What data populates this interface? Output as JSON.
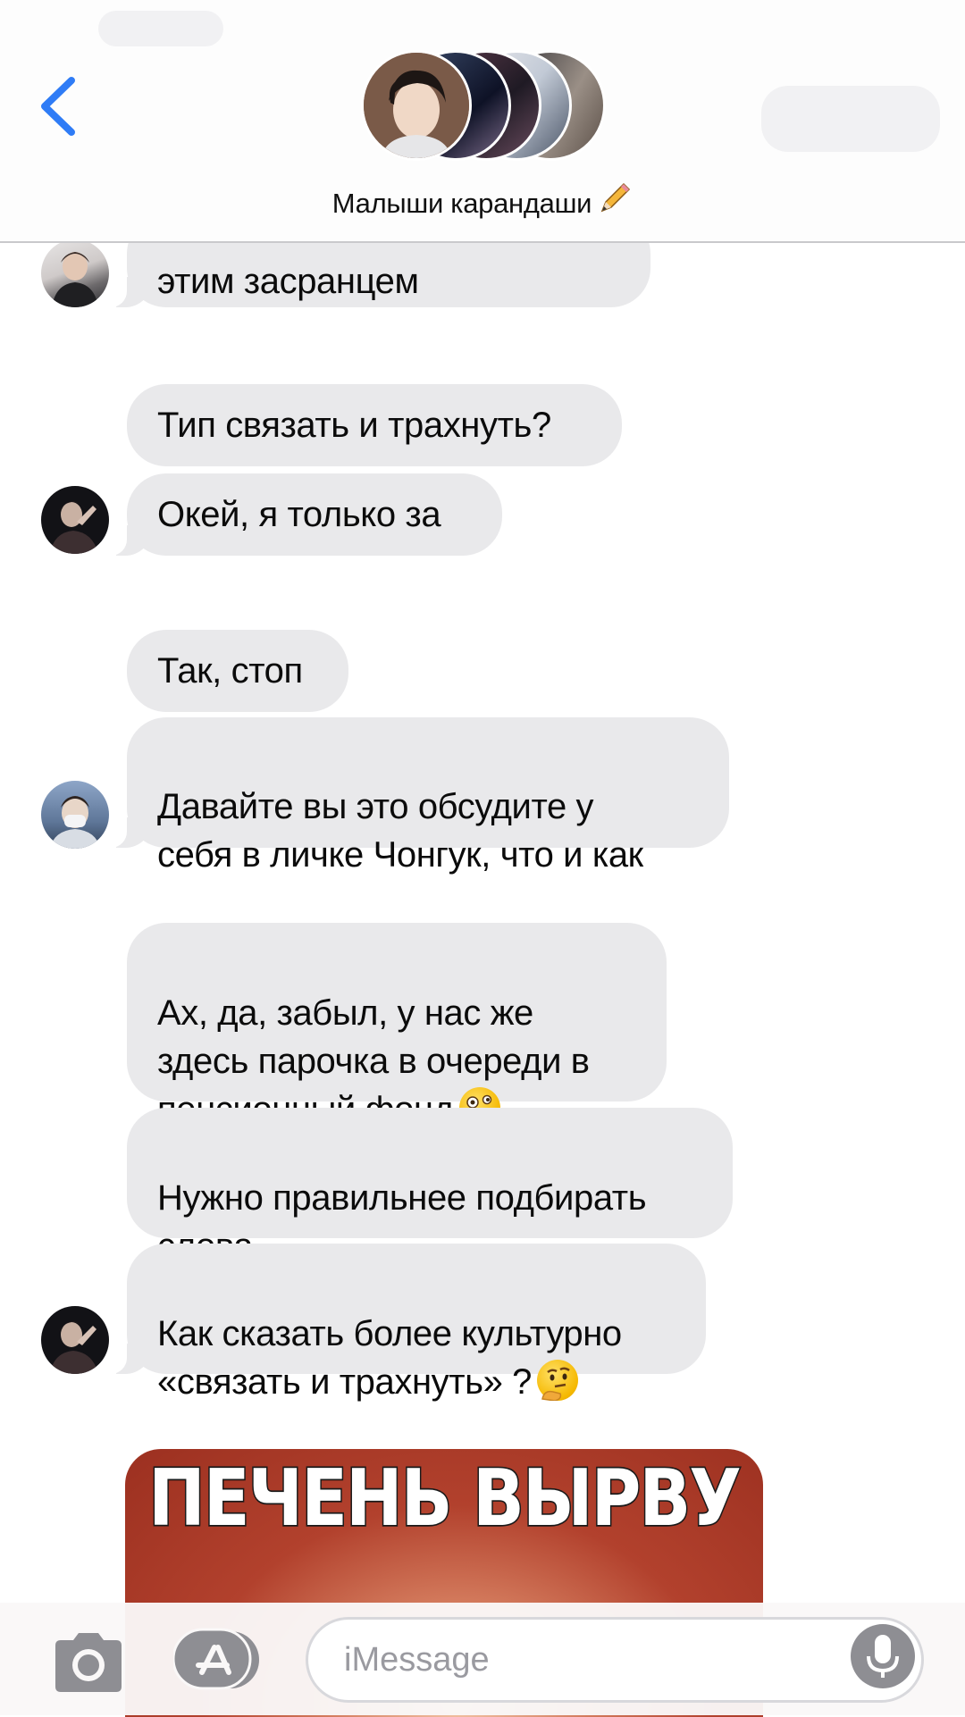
{
  "header": {
    "back_icon": "chevron-left-icon",
    "group_name": "Малыши карандаши",
    "group_emoji": "pencil-icon",
    "accent_color": "#2f7cf6"
  },
  "messages": [
    {
      "id": "m1",
      "text": "этим засранцем",
      "avatar": "avatar-jin"
    },
    {
      "id": "m2",
      "text": "Тип связать и трахнуть?"
    },
    {
      "id": "m3",
      "text": "Окей, я только за",
      "avatar": "avatar-dark"
    },
    {
      "id": "m4",
      "text": "Так, стоп"
    },
    {
      "id": "m5",
      "text": "Давайте вы это обсудите у\nсебя в личке Чонгук, что и как",
      "avatar": "avatar-mask"
    },
    {
      "id": "m6",
      "text": "Ах, да, забыл, у нас же\nздесь парочка в очереди в\nпенсионный фонд",
      "emoji": "zany-face-emoji"
    },
    {
      "id": "m7",
      "text": "Нужно правильнее подбирать\nслова"
    },
    {
      "id": "m8",
      "text": "Как сказать более культурно\n«связать и трахнуть» ?",
      "emoji": "thinking-face-emoji",
      "avatar": "avatar-dark"
    }
  ],
  "meme": {
    "caption": "ПЕЧЕНЬ ВЫРВУ"
  },
  "input_bar": {
    "camera_icon": "camera-icon",
    "apps_icon": "app-store-icon",
    "placeholder": "iMessage",
    "mic_icon": "microphone-icon"
  },
  "colors": {
    "bubble_gray": "#e9e9eb",
    "icon_gray": "#8e8e93"
  }
}
